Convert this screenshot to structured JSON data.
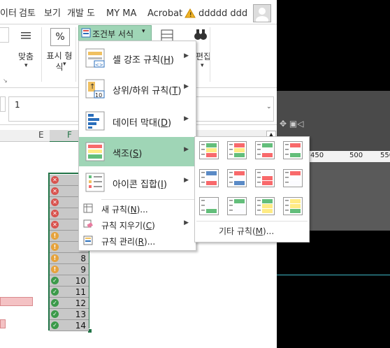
{
  "tabs": [
    "이터",
    "검토",
    "보기",
    "개발 도",
    "MY MA",
    "Acrobat"
  ],
  "user": {
    "name": "ddddd ddd"
  },
  "ribbon": {
    "cond_format_label": "조건부 서식",
    "align_label": "맞춤",
    "number_format_label": "표시 형식",
    "percent_glyph": "%",
    "edit_label": "편집"
  },
  "formula_bar": {
    "value": "1"
  },
  "columns": [
    "E",
    "F"
  ],
  "ruler": {
    "ticks": [
      "450",
      "500",
      "550"
    ]
  },
  "cells": [
    {
      "value": "",
      "icon": "x"
    },
    {
      "value": "",
      "icon": "x"
    },
    {
      "value": "",
      "icon": "x"
    },
    {
      "value": "",
      "icon": "x"
    },
    {
      "value": "",
      "icon": "x"
    },
    {
      "value": "",
      "icon": "excl"
    },
    {
      "value": "",
      "icon": "excl"
    },
    {
      "value": "8",
      "icon": "excl"
    },
    {
      "value": "9",
      "icon": "excl"
    },
    {
      "value": "10",
      "icon": "check"
    },
    {
      "value": "11",
      "icon": "check"
    },
    {
      "value": "12",
      "icon": "check"
    },
    {
      "value": "13",
      "icon": "check"
    },
    {
      "value": "14",
      "icon": "check"
    }
  ],
  "menu": {
    "items": [
      {
        "label": "셀 강조 규칙(",
        "key": "H",
        "tail": ")"
      },
      {
        "label": "상위/하위 규칙(",
        "key": "T",
        "tail": ")"
      },
      {
        "label": "데이터 막대(",
        "key": "D",
        "tail": ")"
      },
      {
        "label": "색조(",
        "key": "S",
        "tail": ")"
      },
      {
        "label": "아이콘 집합(",
        "key": "I",
        "tail": ")"
      }
    ],
    "small_items": [
      {
        "label": "새 규칙(",
        "key": "N",
        "tail": ")..."
      },
      {
        "label": "규칙 지우기(",
        "key": "C",
        "tail": ")"
      },
      {
        "label": "규칙 관리(",
        "key": "R",
        "tail": ")..."
      }
    ]
  },
  "submenu": {
    "more_label": "기타 규칙(",
    "more_key": "M",
    "more_tail": ")..."
  },
  "colors": {
    "highlight": "#9fd5b6",
    "icon_x": "#d9534f",
    "icon_excl": "#e6a23c",
    "icon_check": "#3c9a4a"
  }
}
